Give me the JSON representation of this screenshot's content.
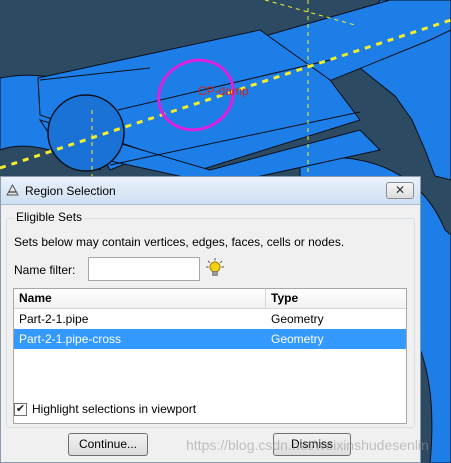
{
  "viewport": {
    "annotation": "CP-damp",
    "colors": {
      "background": "#2d4a63",
      "part": "#1d7ee8",
      "edge": "#0a0f1a",
      "highlight": "#e020e0",
      "axis": "#f2ef2a",
      "label": "#d0241c"
    }
  },
  "dialog": {
    "title": "Region Selection",
    "close_label": "✕",
    "group_label": "Eligible Sets",
    "description": "Sets below may contain vertices, edges, faces, cells or nodes.",
    "filter_label": "Name filter:",
    "filter_value": "",
    "filter_placeholder": "",
    "columns": {
      "name": "Name",
      "type": "Type"
    },
    "rows": [
      {
        "name": "Part-2-1.pipe",
        "type": "Geometry"
      },
      {
        "name": "Part-2-1.pipe-cross",
        "type": "Geometry"
      }
    ],
    "selected_row": 1,
    "highlight_label": "Highlight selections in viewport",
    "highlight_checked": true,
    "continue_label": "Continue...",
    "dismiss_label": "Dismiss",
    "icons": {
      "title": "abaqus-triangle-icon",
      "filter": "lightbulb-icon",
      "close": "close-icon"
    }
  },
  "watermark": "https://blog.csdn.net/weixinshudesenlin"
}
